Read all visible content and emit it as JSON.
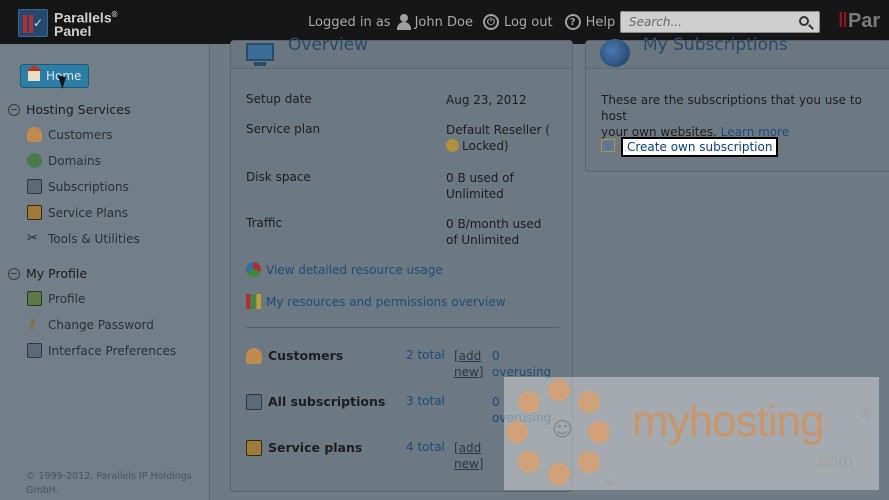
{
  "brand": {
    "name_line1": "Parallels",
    "name_line2": "Panel",
    "reg": "®",
    "right_logo_a": "Par",
    "right_logo_b": ""
  },
  "userbar": {
    "logged_in_as": "Logged in as",
    "user_name": "John Doe",
    "logout": "Log out",
    "help": "Help"
  },
  "search": {
    "placeholder": "Search..."
  },
  "sidebar": {
    "home": "Home",
    "sections": [
      {
        "title": "Hosting Services",
        "items": [
          "Customers",
          "Domains",
          "Subscriptions",
          "Service Plans",
          "Tools & Utilities"
        ]
      },
      {
        "title": "My Profile",
        "items": [
          "Profile",
          "Change Password",
          "Interface Preferences"
        ]
      }
    ],
    "copyright": "© 1999-2012. Parallels IP Holdings GmbH."
  },
  "overview": {
    "title": "Overview",
    "rows": [
      {
        "label": "Setup date",
        "value": "Aug 23, 2012"
      },
      {
        "label": "Service plan",
        "value": "Default Reseller (",
        "value2": "Locked)"
      },
      {
        "label": "Disk space",
        "value": "0 B used of",
        "value2": "Unlimited"
      },
      {
        "label": "Traffic",
        "value": "0 B/month used",
        "value2": "of Unlimited"
      }
    ],
    "links": [
      "View detailed resource usage",
      "My resources and permissions overview"
    ],
    "summary": [
      {
        "label": "Customers",
        "total": "2 total",
        "add1": "[add",
        "add2": "new]",
        "over1": "0",
        "over2": "overusing"
      },
      {
        "label": "All subscriptions",
        "total": "3 total",
        "over1": "0",
        "over2": "overusing"
      },
      {
        "label": "Service plans",
        "total": "4 total",
        "add1": "[add",
        "add2": "new]"
      }
    ]
  },
  "subscriptions": {
    "title": "My Subscriptions",
    "desc1": "These are the subscriptions that you use to host",
    "desc2": "your own websites.",
    "learn_more": "Learn more",
    "create": "Create own subscription"
  },
  "watermark": {
    "brand": "myhosting",
    "reg": "®",
    "dotcom": ".com",
    "reg2": "®"
  }
}
